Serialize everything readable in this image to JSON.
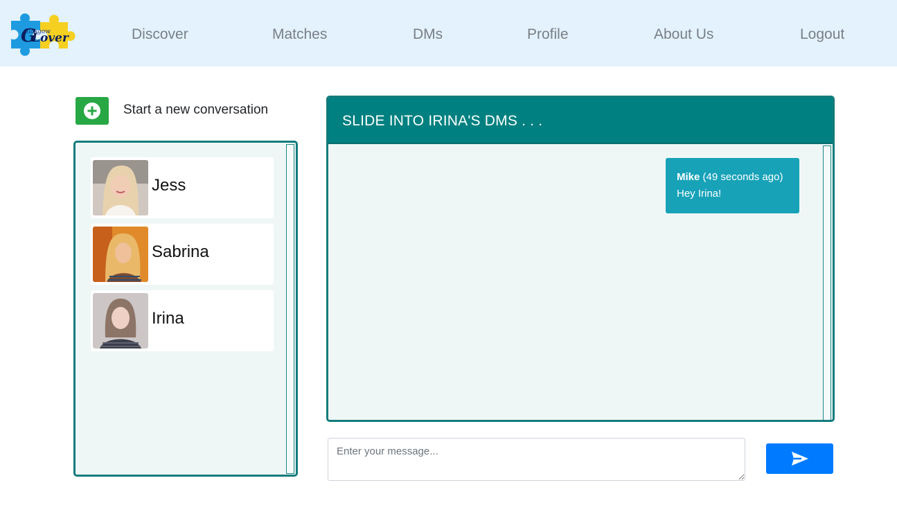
{
  "navbar": {
    "logo_text": "Glasgow Lover",
    "links": [
      "Discover",
      "Matches",
      "DMs",
      "Profile",
      "About Us",
      "Logout"
    ]
  },
  "new_conversation": {
    "icon": "plus-circle-icon",
    "label": "Start a new conversation"
  },
  "contacts": [
    {
      "name": "Jess"
    },
    {
      "name": "Sabrina"
    },
    {
      "name": "Irina"
    }
  ],
  "chat": {
    "title": "SLIDE INTO IRINA'S DMS . . .",
    "messages": [
      {
        "sender": "Mike",
        "time": "(49 seconds ago)",
        "text": "Hey Irina!"
      }
    ]
  },
  "composer": {
    "placeholder": "Enter your message...",
    "send_icon": "paper-plane-icon"
  },
  "colors": {
    "navbar_bg": "#e3f2fd",
    "teal": "#008080",
    "bubble": "#17a2b8",
    "send_button": "#007bff",
    "new_button": "#28a745"
  }
}
